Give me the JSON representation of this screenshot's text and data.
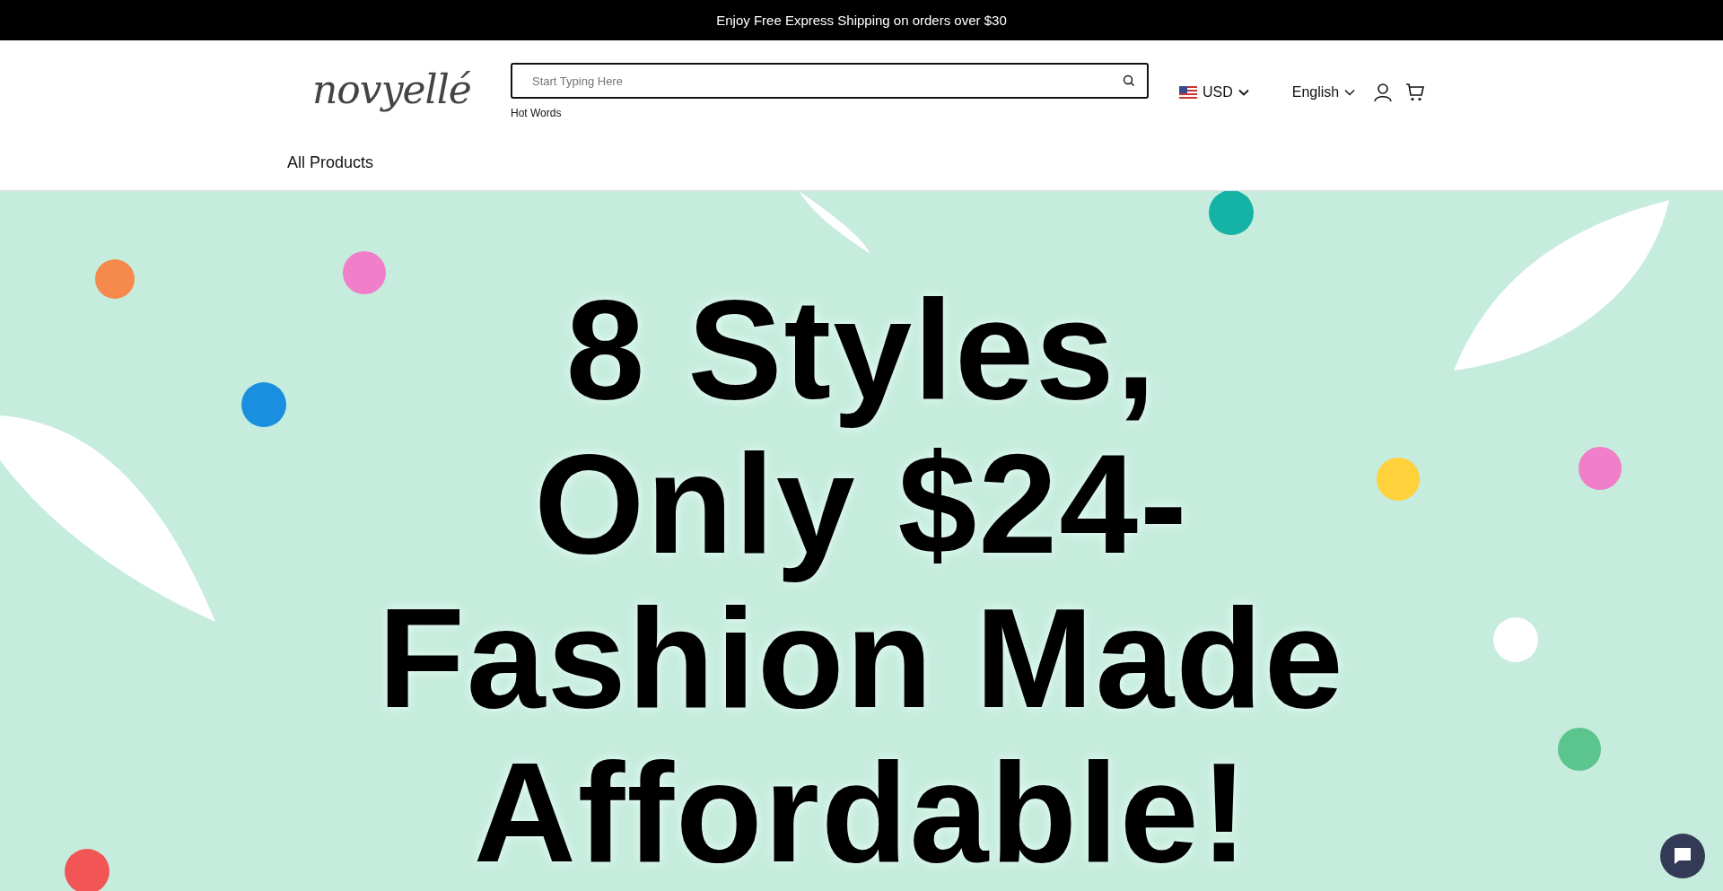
{
  "announcement": "Enjoy Free Express Shipping on orders over $30",
  "logo": "novyellé",
  "search": {
    "placeholder": "Start Typing Here",
    "hot_words_label": "Hot Words"
  },
  "currency": "USD",
  "language": "English",
  "nav": [
    {
      "label": "All Products"
    }
  ],
  "banner": {
    "headline": [
      "8 Styles,",
      "Only $24-",
      "Fashion Made",
      "Affordable!"
    ]
  }
}
